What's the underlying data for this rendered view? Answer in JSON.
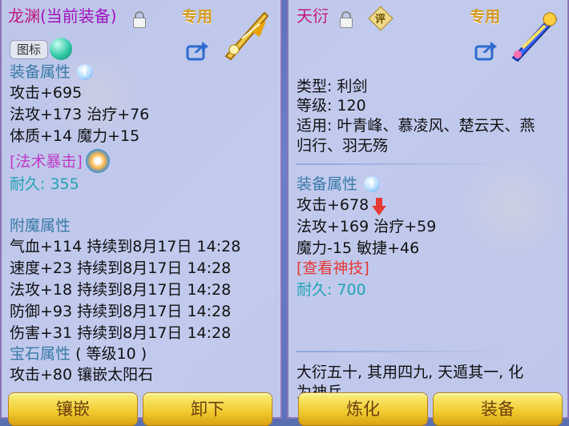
{
  "left": {
    "title": "龙渊",
    "title_paren": "(当前装备)",
    "exclusive": "专用",
    "icon_badge": "图标",
    "section_equip": "装备属性",
    "attrs": [
      "攻击+695",
      "法攻+173 治疗+76",
      "体质+14 魔力+15"
    ],
    "skill": "[法术暴击]",
    "durability": "耐久: 355",
    "section_enchant": "附魔属性",
    "enchants": [
      "气血+114 持续到8月17日 14:28",
      "速度+23 持续到8月17日 14:28",
      "法攻+18 持续到8月17日 14:28",
      "防御+93 持续到8月17日 14:28",
      "伤害+31 持续到8月17日 14:28"
    ],
    "section_gem": "宝石属性",
    "gem_level": "( 等级10 )",
    "gem_line": "攻击+80 镶嵌太阳石",
    "buttons": [
      "镶嵌",
      "卸下"
    ]
  },
  "right": {
    "title": "天衍",
    "eval_label": "评",
    "exclusive": "专用",
    "info_lines": [
      "类型: 利剑",
      "等级: 120",
      "适用: 叶青峰、慕凌风、楚云天、燕",
      "归行、羽无殇"
    ],
    "section_equip": "装备属性",
    "attrs": [
      "攻击+678",
      "法攻+169 治疗+59",
      "魔力-15 敏捷+46"
    ],
    "skill_link": "[查看神技]",
    "durability": "耐久: 700",
    "flavor_1": "大衍五十, 其用四九, 天遁其一, 化",
    "flavor_2": "为神兵",
    "buttons": [
      "炼化",
      "装备"
    ]
  },
  "colors": {
    "title": "#c2187f",
    "section": "#3a7aa8",
    "durability": "#22a3b5",
    "skill": "#c03ac8",
    "link": "#e53935",
    "exclusive": "#d79b1d",
    "button": "#f0c92d"
  }
}
